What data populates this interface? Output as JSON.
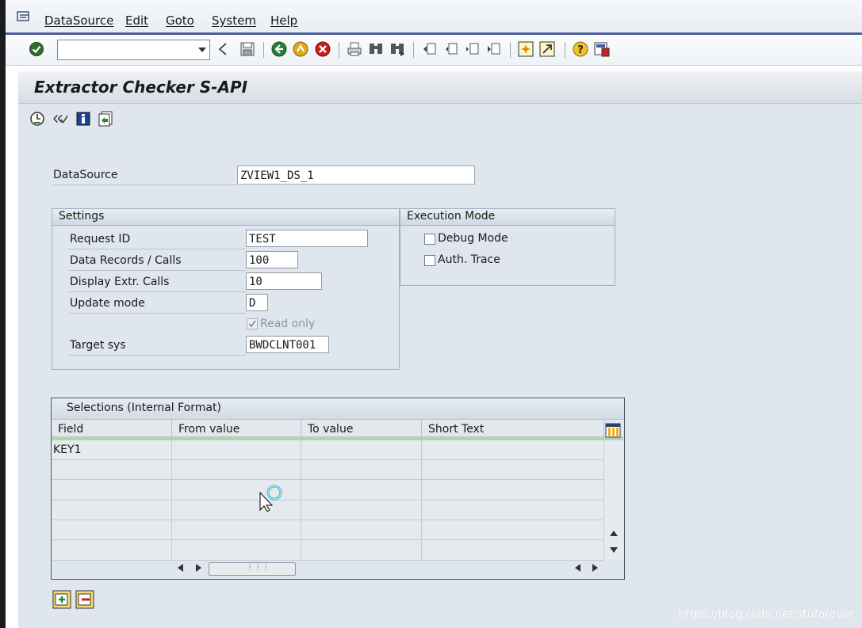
{
  "menu": {
    "items": [
      {
        "label": "DataSource"
      },
      {
        "label": "Edit"
      },
      {
        "label": "Goto"
      },
      {
        "label": "System"
      },
      {
        "label": "Help"
      }
    ]
  },
  "toolbar": {
    "command_field_value": "",
    "icons": [
      "enter-icon",
      "back-arrow-icon",
      "save-icon",
      "back-icon",
      "exit-icon",
      "cancel-icon",
      "print-icon",
      "find-icon",
      "find-next-icon",
      "first-page-icon",
      "previous-page-icon",
      "next-page-icon",
      "last-page-icon",
      "create-session-icon",
      "shortcut-icon",
      "help-icon",
      "customize-layout-icon"
    ]
  },
  "title": "Extractor Checker S-API",
  "app_toolbar": {
    "icons": [
      "execute-icon",
      "check-icon",
      "info-icon",
      "variant-icon"
    ]
  },
  "form": {
    "datasource_label": "DataSource",
    "datasource_value": "ZVIEW1_DS_1"
  },
  "settings": {
    "title": "Settings",
    "request_id_label": "Request ID",
    "request_id_value": "TEST",
    "data_records_label": "Data Records / Calls",
    "data_records_value": "100",
    "display_calls_label": "Display Extr. Calls",
    "display_calls_value": "10",
    "update_mode_label": "Update mode",
    "update_mode_value": "D",
    "read_only_label": "Read only",
    "read_only_checked": true,
    "target_sys_label": "Target sys",
    "target_sys_value": "BWDCLNT001"
  },
  "execution_mode": {
    "title": "Execution Mode",
    "debug_mode_label": "Debug Mode",
    "debug_mode_checked": false,
    "auth_trace_label": "Auth. Trace",
    "auth_trace_checked": false
  },
  "selections": {
    "title": "Selections (Internal Format)",
    "columns": [
      "Field",
      "From value",
      "To value",
      "Short Text"
    ],
    "rows": [
      [
        "KEY1",
        "",
        "",
        ""
      ],
      [
        "",
        "",
        "",
        ""
      ],
      [
        "",
        "",
        "",
        ""
      ],
      [
        "",
        "",
        "",
        ""
      ],
      [
        "",
        "",
        "",
        ""
      ],
      [
        "",
        "",
        "",
        ""
      ]
    ]
  },
  "bottom_buttons": [
    "insert-row-icon",
    "delete-row-icon"
  ],
  "watermark": "https://blog.csdn.net/stuforever",
  "colors": {
    "menu_accent": "#4c5c9c",
    "background": "#dfe6ed",
    "groupbox_border": "#9fb0c2"
  }
}
